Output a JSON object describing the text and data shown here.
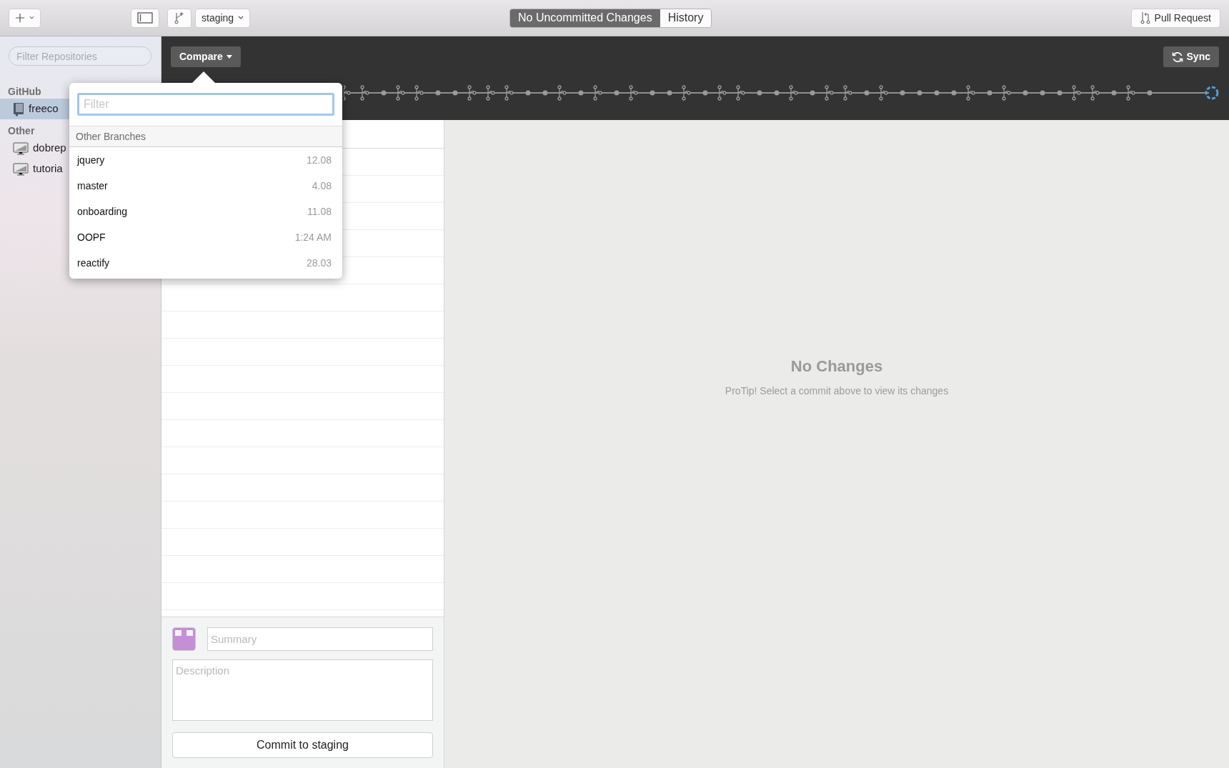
{
  "toolbar": {
    "branch_selector": "staging",
    "mode_tabs": [
      {
        "label": "No Uncommitted Changes",
        "selected": true
      },
      {
        "label": "History",
        "selected": false
      }
    ],
    "pull_request_button": "Pull Request"
  },
  "sidebar": {
    "filter_placeholder": "Filter Repositories",
    "sections": [
      {
        "title": "GitHub",
        "items": [
          {
            "label": "freeco",
            "kind": "repo",
            "selected": true
          }
        ]
      },
      {
        "title": "Other",
        "items": [
          {
            "label": "dobrep",
            "kind": "local",
            "selected": false
          },
          {
            "label": "tutoria",
            "kind": "local",
            "selected": false
          }
        ]
      }
    ]
  },
  "timeline": {
    "compare_button": "Compare",
    "sync_button": "Sync"
  },
  "compare_popover": {
    "filter_placeholder": "Filter",
    "section_title": "Other Branches",
    "branches": [
      {
        "name": "jquery",
        "date": "12.08"
      },
      {
        "name": "master",
        "date": "4.08"
      },
      {
        "name": "onboarding",
        "date": "11.08"
      },
      {
        "name": "OOPF",
        "date": "1:24 AM"
      },
      {
        "name": "reactify",
        "date": "28.03"
      }
    ]
  },
  "commit_form": {
    "summary_placeholder": "Summary",
    "description_placeholder": "Description",
    "commit_button": "Commit to staging"
  },
  "empty_state": {
    "title": "No Changes",
    "hint": "ProTip! Select a commit above to view its changes"
  }
}
